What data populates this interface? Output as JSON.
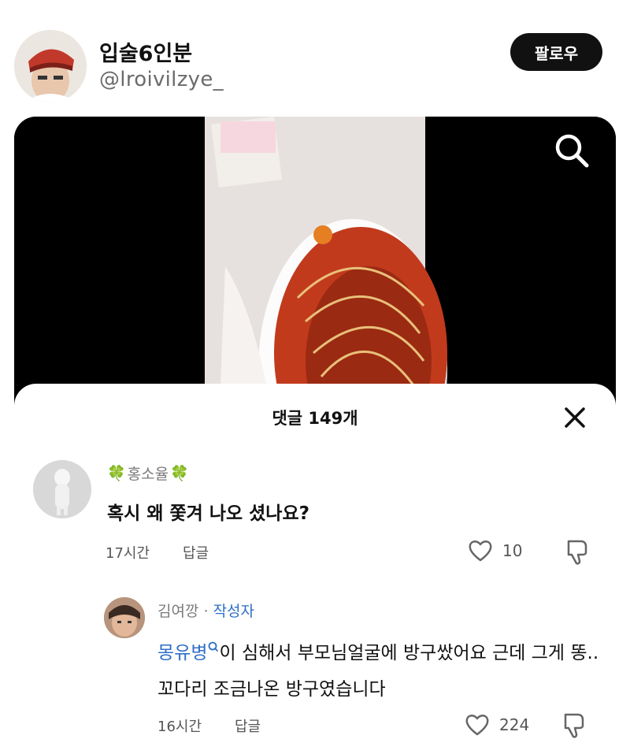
{
  "post": {
    "display_name": "입술6인분",
    "handle": "@lroivilzye_",
    "follow_label": "팔로우"
  },
  "video": {
    "search_icon": "search-icon"
  },
  "comments_sheet": {
    "title": "댓글 149개",
    "close_icon": "close-icon",
    "comments": [
      {
        "user_prefix": "🍀",
        "user_name": "홍소율",
        "user_suffix": "🍀",
        "text": "혹시 왜 쫓겨 나오 셨나요?",
        "time": "17시간",
        "reply_label": "답글",
        "likes": "10"
      },
      {
        "user_name": "김여깡",
        "separator": " · ",
        "author_badge": "작성자",
        "mention": "몽유병",
        "text": "이 심해서 부모님얼굴에 방구쌌어요 근데 그게 똥..꼬다리 조금나온 방구였습니다",
        "time": "16시간",
        "reply_label": "답글",
        "likes": "224"
      }
    ]
  },
  "colors": {
    "follow_bg": "#111111",
    "accent_blue": "#2f6ec7",
    "muted": "#7a7a7a"
  }
}
